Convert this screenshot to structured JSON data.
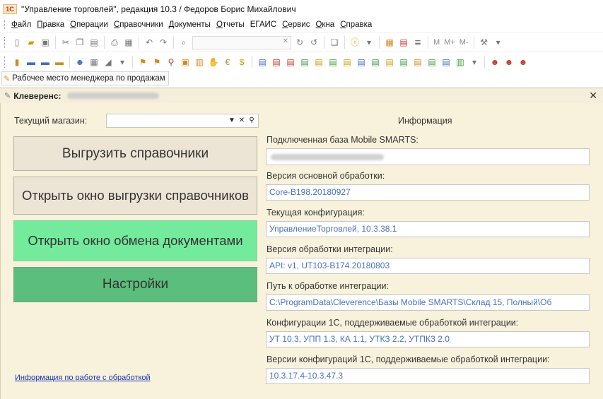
{
  "window": {
    "title": "\"Управление торговлей\", редакция 10.3 / Федоров Борис Михайлович",
    "logo_text": "1C"
  },
  "menu": {
    "items": [
      {
        "key": "file",
        "label": "Файл",
        "ul": "Ф",
        "rest": "айл"
      },
      {
        "key": "edit",
        "label": "Правка",
        "ul": "П",
        "rest": "равка"
      },
      {
        "key": "operations",
        "label": "Операции",
        "ul": "О",
        "rest": "перации"
      },
      {
        "key": "references",
        "label": "Справочники",
        "ul": "С",
        "rest": "правочники"
      },
      {
        "key": "documents",
        "label": "Документы",
        "ul": "Д",
        "rest": "окументы"
      },
      {
        "key": "reports",
        "label": "Отчеты",
        "ul": "О",
        "rest": "тчеты"
      },
      {
        "key": "egais",
        "label": "ЕГАИС",
        "ul": "",
        "rest": "ЕГАИС"
      },
      {
        "key": "service",
        "label": "Сервис",
        "ul": "С",
        "rest": "ервис"
      },
      {
        "key": "windows",
        "label": "Окна",
        "ul": "О",
        "rest": "кна"
      },
      {
        "key": "help",
        "label": "Справка",
        "ul": "С",
        "rest": "правка"
      }
    ]
  },
  "toolbar": {
    "m_label": "M",
    "mplus_label": "M+",
    "mminus_label": "M-"
  },
  "nav": {
    "tab_label": "Рабочее место менеджера по продажам"
  },
  "form": {
    "title": "Клеверенс:",
    "store_label": "Текущий магазин:",
    "store_value": "",
    "buttons": {
      "upload_refs": "Выгрузить справочники",
      "open_upload_window": "Открыть окно выгрузки справочников",
      "open_exchange_window": "Открыть окно обмена документами",
      "settings": "Настройки"
    },
    "help_link": "Информация по работе с обработкой",
    "info_title": "Информация",
    "info": [
      {
        "label": "Подключенная база Mobile SMARTS:",
        "value": ""
      },
      {
        "label": "Версия основной обработки:",
        "value": "Core-B198.20180927"
      },
      {
        "label": "Текущая конфигурация:",
        "value": "УправлениеТорговлей, 10.3.38.1"
      },
      {
        "label": "Версия обработки интеграции:",
        "value": "API: v1, UT103-B174.20180803"
      },
      {
        "label": "Путь к обработке интеграции:",
        "value": "C:\\ProgramData\\Cleverence\\Базы Mobile SMARTS\\Склад 15, Полный\\Об"
      },
      {
        "label": "Конфигурации 1С, поддерживаемые обработкой интеграции:",
        "value": "УТ 10.3, УПП 1.3, КА 1.1, УТКЗ 2.2, УТПКЗ 2.0"
      },
      {
        "label": "Версии конфигураций 1С, поддерживаемые обработкой интеграции:",
        "value": "10.3.17.4-10.3.47.3"
      }
    ]
  }
}
